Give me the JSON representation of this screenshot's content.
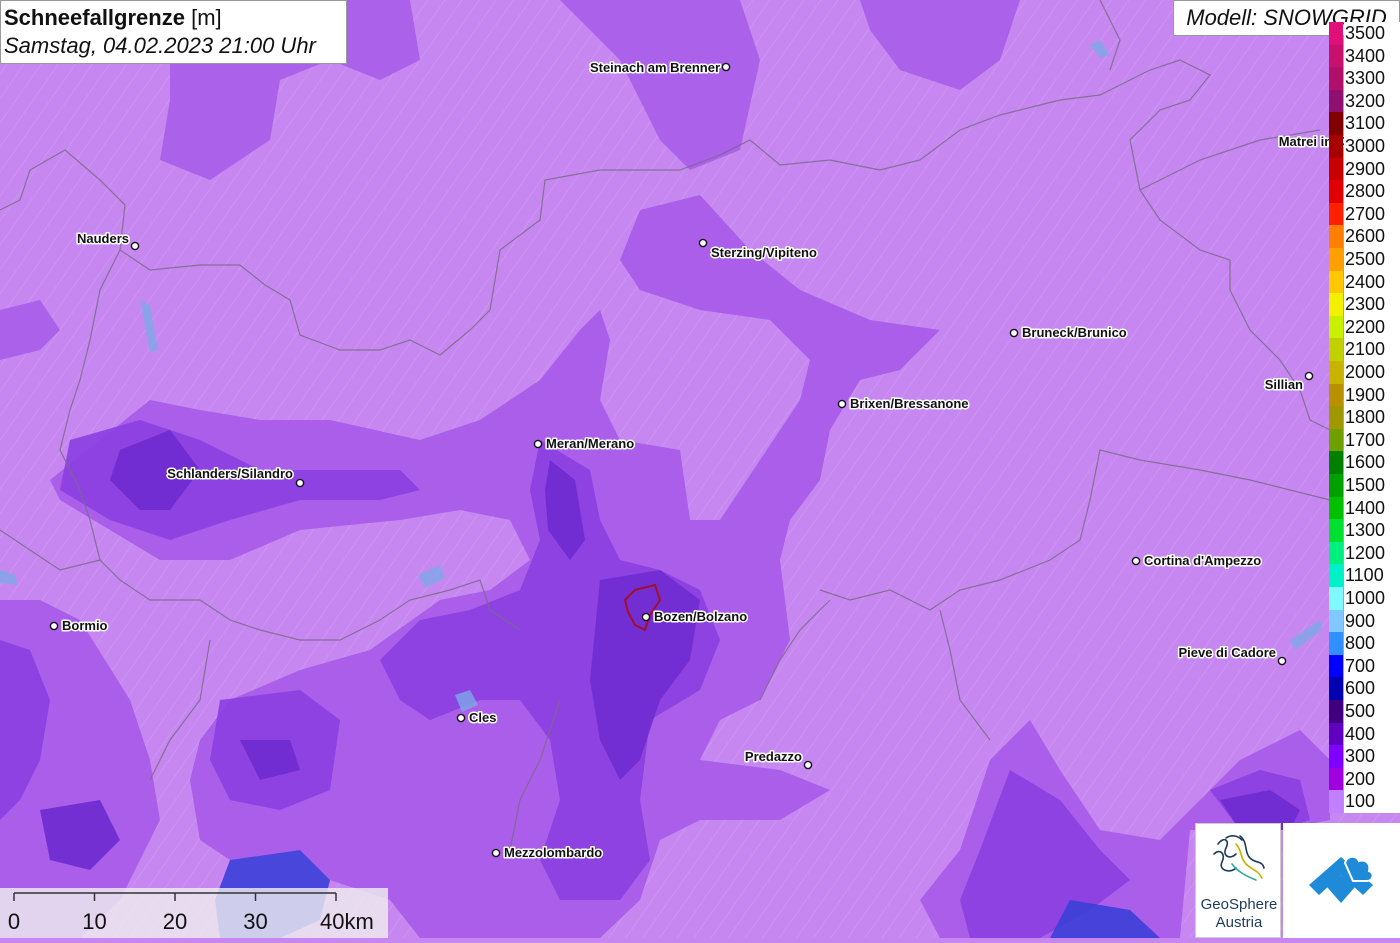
{
  "title": {
    "main": "Schneefallgrenze",
    "unit": "[m]",
    "datetime": "Samstag, 04.02.2023 21:00 Uhr"
  },
  "model_label": "Modell: SNOWGRID",
  "legend": {
    "entries": [
      {
        "value": "3500",
        "color": "#e0107a"
      },
      {
        "value": "3400",
        "color": "#c8106e"
      },
      {
        "value": "3300",
        "color": "#b0106a"
      },
      {
        "value": "3200",
        "color": "#901070"
      },
      {
        "value": "3100",
        "color": "#800000"
      },
      {
        "value": "3000",
        "color": "#a80000"
      },
      {
        "value": "2900",
        "color": "#c80000"
      },
      {
        "value": "2800",
        "color": "#e00000"
      },
      {
        "value": "2700",
        "color": "#ff2000"
      },
      {
        "value": "2600",
        "color": "#ff8000"
      },
      {
        "value": "2500",
        "color": "#ffa000"
      },
      {
        "value": "2400",
        "color": "#ffc800"
      },
      {
        "value": "2300",
        "color": "#f0f000"
      },
      {
        "value": "2200",
        "color": "#c8f000"
      },
      {
        "value": "2100",
        "color": "#c0d000"
      },
      {
        "value": "2000",
        "color": "#c8b400"
      },
      {
        "value": "1900",
        "color": "#b89000"
      },
      {
        "value": "1800",
        "color": "#a09800"
      },
      {
        "value": "1700",
        "color": "#70a000"
      },
      {
        "value": "1600",
        "color": "#008000"
      },
      {
        "value": "1500",
        "color": "#00a000"
      },
      {
        "value": "1400",
        "color": "#00c000"
      },
      {
        "value": "1300",
        "color": "#00e030"
      },
      {
        "value": "1200",
        "color": "#00f080"
      },
      {
        "value": "1100",
        "color": "#00f0c8"
      },
      {
        "value": "1000",
        "color": "#80f8ff"
      },
      {
        "value": "900",
        "color": "#80c8ff"
      },
      {
        "value": "800",
        "color": "#3090ff"
      },
      {
        "value": "700",
        "color": "#0000ff"
      },
      {
        "value": "600",
        "color": "#0000b0"
      },
      {
        "value": "500",
        "color": "#400080"
      },
      {
        "value": "400",
        "color": "#6000c0"
      },
      {
        "value": "300",
        "color": "#8000ff"
      },
      {
        "value": "200",
        "color": "#a000e0"
      },
      {
        "value": "100",
        "color": "#c080ff"
      }
    ]
  },
  "cities": [
    {
      "name": "Steinach am Brenner",
      "anchor": "end"
    },
    {
      "name": "Matrei in Osttirol",
      "anchor": "end"
    },
    {
      "name": "Nauders",
      "anchor": "end"
    },
    {
      "name": "Sterzing/Vipiteno",
      "anchor": "start"
    },
    {
      "name": "Bruneck/Brunico",
      "anchor": "start"
    },
    {
      "name": "Sillian",
      "anchor": "end"
    },
    {
      "name": "Brixen/Bressanone",
      "anchor": "start"
    },
    {
      "name": "Meran/Merano",
      "anchor": "start"
    },
    {
      "name": "Schlanders/Silandro",
      "anchor": "start"
    },
    {
      "name": "Cortina d'Ampezzo",
      "anchor": "start"
    },
    {
      "name": "Bormio",
      "anchor": "start"
    },
    {
      "name": "Bozen/Bolzano",
      "anchor": "start"
    },
    {
      "name": "Pieve di Cadore",
      "anchor": "end"
    },
    {
      "name": "Cles",
      "anchor": "start"
    },
    {
      "name": "Predazzo",
      "anchor": "end"
    },
    {
      "name": "Mezzolombardo",
      "anchor": "start"
    }
  ],
  "scalebar": {
    "ticks": [
      "0",
      "10",
      "20",
      "30",
      "40km"
    ]
  },
  "logos": {
    "geosphere": "GeoSphere Austria",
    "geosphere_line1": "GeoSphere",
    "geosphere_line2": "Austria"
  },
  "colors": {
    "base_land": "#c688f0",
    "zone_mid": "#a65ae8",
    "zone_dark": "#8a3fe0",
    "zone_deep": "#6e2ad0",
    "zone_blue": "#3b3fd8",
    "border": "#7a6a88",
    "bozen_outline": "#a0102a"
  }
}
